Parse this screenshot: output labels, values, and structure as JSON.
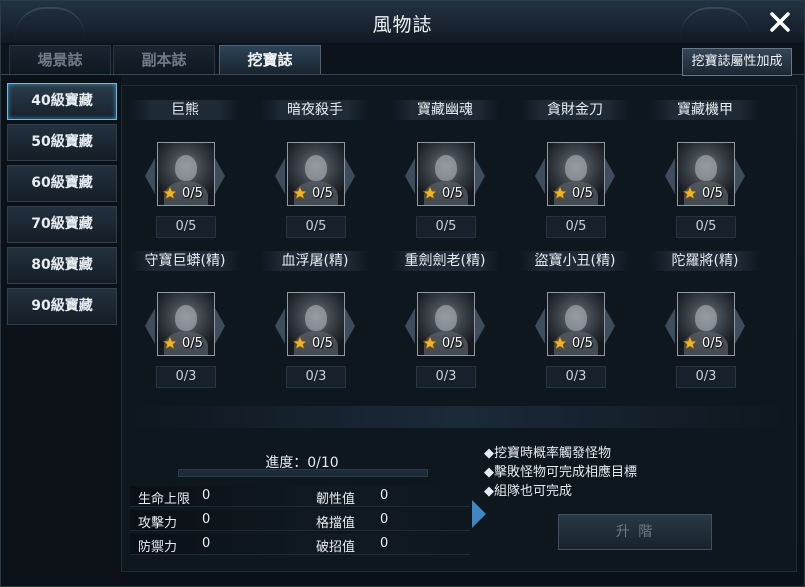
{
  "window": {
    "title": "風物誌",
    "close_label": "✕"
  },
  "tabs": [
    {
      "label": "場景誌",
      "active": false
    },
    {
      "label": "副本誌",
      "active": false
    },
    {
      "label": "挖寶誌",
      "active": true
    }
  ],
  "attr_button": {
    "label": "挖寶誌屬性加成"
  },
  "sidebar": {
    "items": [
      {
        "label": "40級寶藏",
        "active": true
      },
      {
        "label": "50級寶藏",
        "active": false
      },
      {
        "label": "60級寶藏",
        "active": false
      },
      {
        "label": "70級寶藏",
        "active": false
      },
      {
        "label": "80級寶藏",
        "active": false
      },
      {
        "label": "90級寶藏",
        "active": false
      }
    ]
  },
  "monsters": {
    "row1": [
      {
        "name": "巨熊",
        "portrait_count": "0/5",
        "goal": "0/5"
      },
      {
        "name": "暗夜殺手",
        "portrait_count": "0/5",
        "goal": "0/5"
      },
      {
        "name": "寶藏幽魂",
        "portrait_count": "0/5",
        "goal": "0/5"
      },
      {
        "name": "貪財金刀",
        "portrait_count": "0/5",
        "goal": "0/5"
      },
      {
        "name": "寶藏機甲",
        "portrait_count": "0/5",
        "goal": "0/5"
      }
    ],
    "row2": [
      {
        "name": "守寶巨蟒(精)",
        "portrait_count": "0/5",
        "goal": "0/3"
      },
      {
        "name": "血浮屠(精)",
        "portrait_count": "0/5",
        "goal": "0/3"
      },
      {
        "name": "重劍劍老(精)",
        "portrait_count": "0/5",
        "goal": "0/3"
      },
      {
        "name": "盜寶小丑(精)",
        "portrait_count": "0/5",
        "goal": "0/3"
      },
      {
        "name": "陀羅將(精)",
        "portrait_count": "0/5",
        "goal": "0/3"
      }
    ]
  },
  "progress": {
    "label": "進度：0/10",
    "fraction": 0
  },
  "stats": [
    {
      "label": "生命上限",
      "value": "0"
    },
    {
      "label": "韌性值",
      "value": "0"
    },
    {
      "label": "攻擊力",
      "value": "0"
    },
    {
      "label": "格擋值",
      "value": "0"
    },
    {
      "label": "防禦力",
      "value": "0"
    },
    {
      "label": "破招值",
      "value": "0"
    }
  ],
  "notes": [
    "◆挖寶時概率觸發怪物",
    "◆擊敗怪物可完成相應目標",
    "◆組隊也可完成"
  ],
  "upgrade_button": {
    "label": "升 階"
  },
  "colors": {
    "accent": "#6fb8df",
    "star": "#f0b429",
    "arrow": "#3f86c4"
  },
  "icons": {
    "close": "close-icon",
    "star": "star-icon",
    "arrow": "arrow-right-icon"
  }
}
